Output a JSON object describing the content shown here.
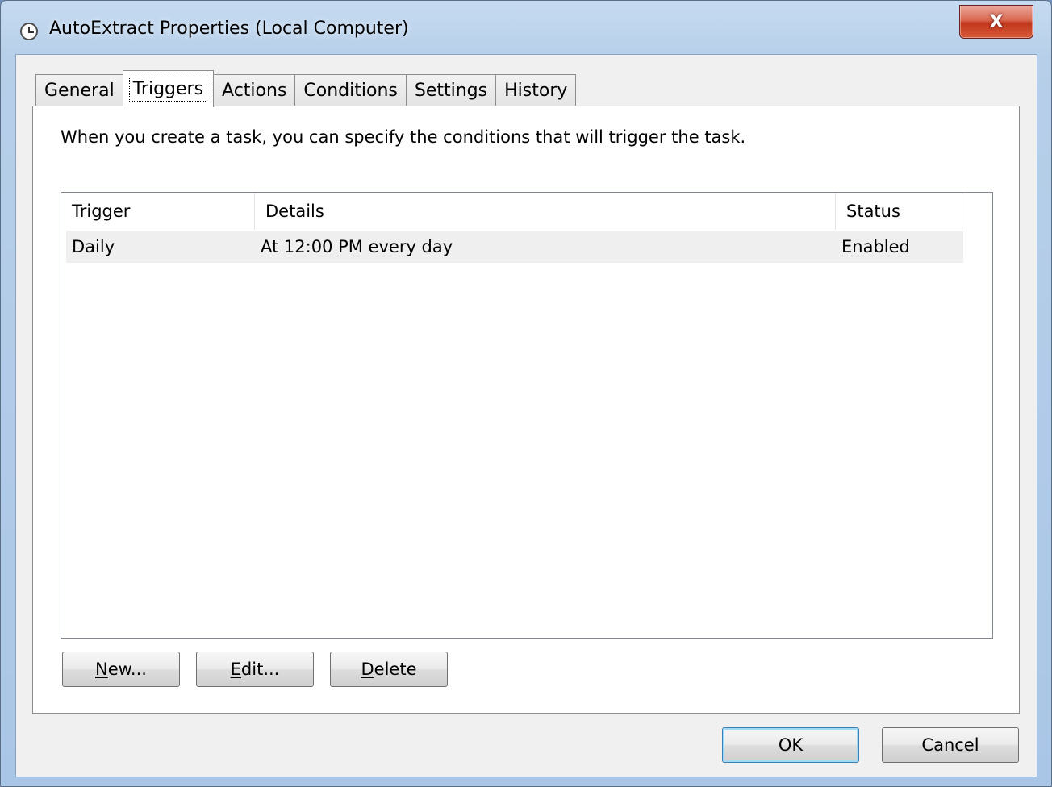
{
  "window": {
    "title": "AutoExtract Properties (Local Computer)",
    "close_label": "X"
  },
  "tabs": [
    {
      "label": "General"
    },
    {
      "label": "Triggers"
    },
    {
      "label": "Actions"
    },
    {
      "label": "Conditions"
    },
    {
      "label": "Settings"
    },
    {
      "label": "History"
    }
  ],
  "active_tab": "Triggers",
  "description": "When you create a task, you can specify the conditions that will trigger the task.",
  "triggers_table": {
    "columns": [
      {
        "label": "Trigger"
      },
      {
        "label": "Details"
      },
      {
        "label": "Status"
      }
    ],
    "rows": [
      {
        "trigger": "Daily",
        "details": "At 12:00 PM every day",
        "status": "Enabled"
      }
    ]
  },
  "action_buttons": {
    "new": {
      "mnemonic": "N",
      "rest": "ew..."
    },
    "edit": {
      "mnemonic": "E",
      "rest": "dit..."
    },
    "delete": {
      "mnemonic": "D",
      "rest": "elete"
    }
  },
  "dialog_buttons": {
    "ok": "OK",
    "cancel": "Cancel"
  },
  "icons": {
    "title": "clock-icon",
    "close": "close-icon"
  },
  "colors": {
    "close_button": "#c1371d",
    "selected_row": "#efefef",
    "default_button_border": "#3c7fb1"
  }
}
